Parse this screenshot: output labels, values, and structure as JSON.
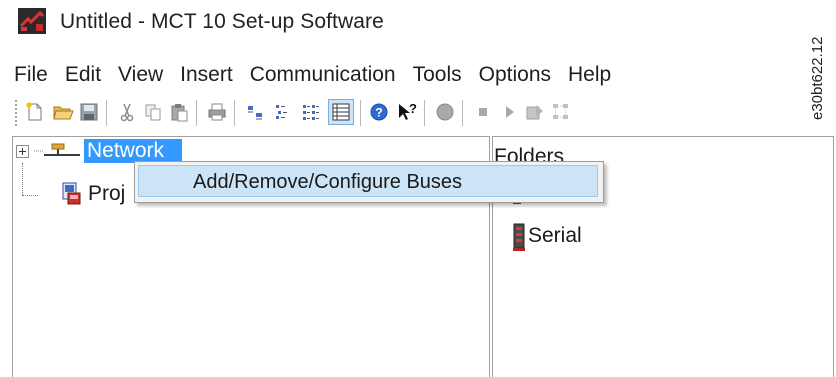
{
  "window": {
    "title": "Untitled - MCT 10 Set-up Software",
    "icon": "mct10-app-icon"
  },
  "menubar": {
    "items": [
      "File",
      "Edit",
      "View",
      "Insert",
      "Communication",
      "Tools",
      "Options",
      "Help"
    ]
  },
  "toolbar": {
    "buttons": [
      "new-icon",
      "open-folder-icon",
      "save-icon",
      "cut-icon",
      "copy-icon",
      "paste-icon",
      "print-icon",
      "large-icons-view-icon",
      "small-icons-view-icon",
      "list-view-icon",
      "details-view-icon",
      "help-icon",
      "context-help-icon",
      "record-icon",
      "stop-icon",
      "play-icon",
      "export-icon",
      "network-scan-icon"
    ]
  },
  "tree": {
    "network_label": "Network",
    "project_label": "Proj",
    "selected_color": "#3399ff"
  },
  "context_menu": {
    "item_label": "Add/Remove/Configure Buses",
    "hover_color": "#cce4f7"
  },
  "right_pane": {
    "header": "Folders",
    "items": [
      {
        "label": "",
        "icon": "bus-icon"
      },
      {
        "label": "Serial",
        "icon": "serial-port-icon"
      }
    ]
  },
  "document_code": "e30bt622.12"
}
